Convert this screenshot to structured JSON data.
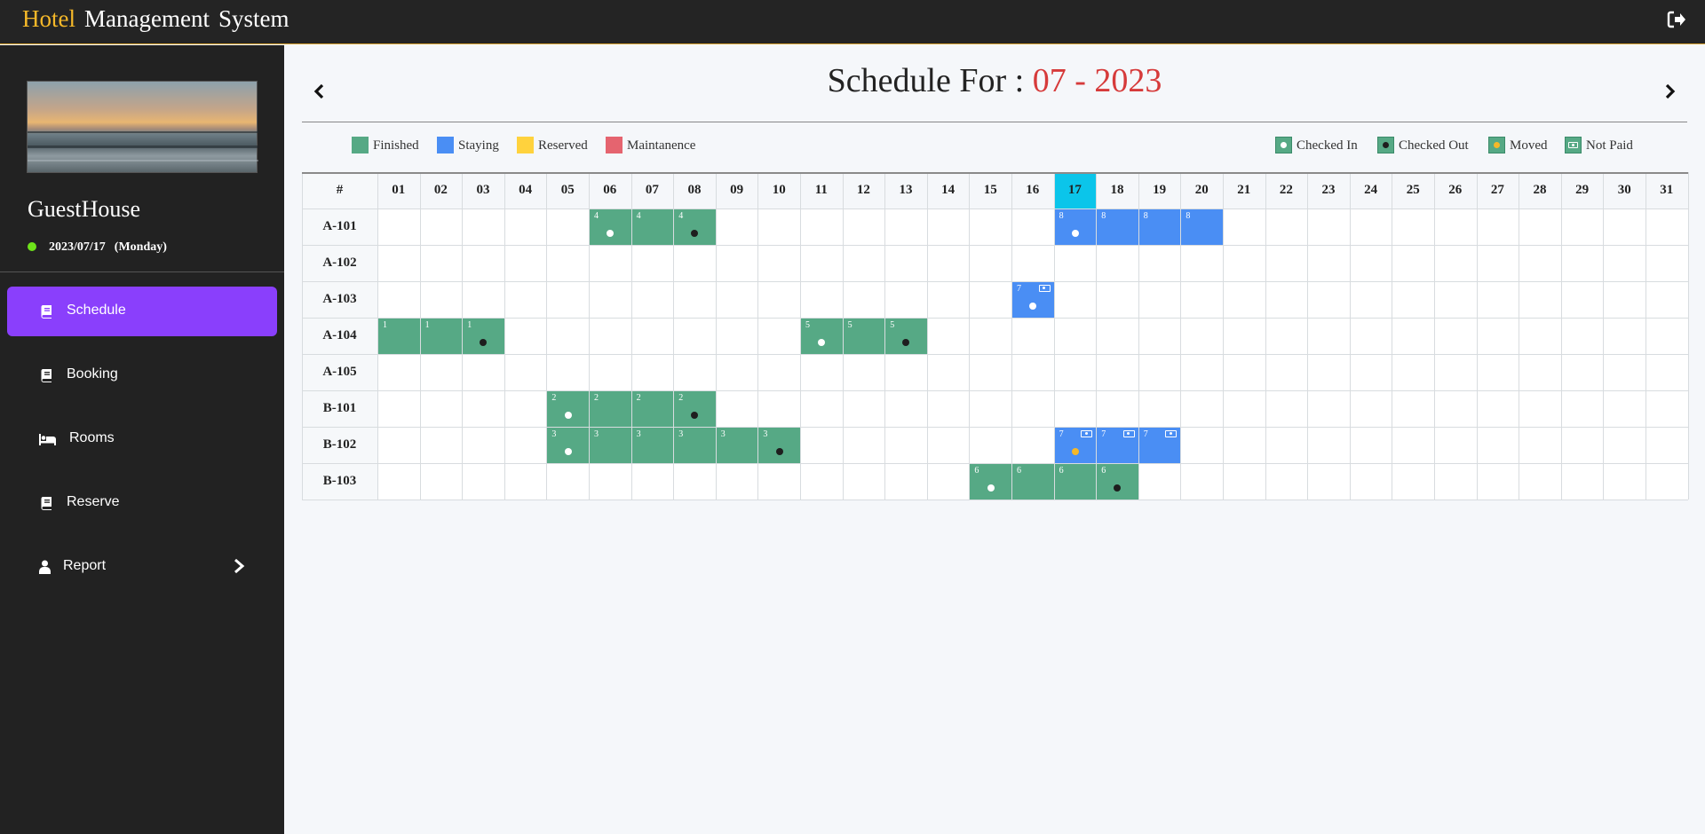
{
  "app": {
    "title_part1": "Hotel",
    "title_part2": "Management",
    "title_part3": "System"
  },
  "topbar": {
    "logout_icon": "sign-out-icon"
  },
  "sidebar": {
    "property_name": "GuestHouse",
    "current_date": "2023/07/17",
    "current_day": "(Monday)",
    "status_color": "#6ee31a",
    "items": [
      {
        "label": "Schedule",
        "icon": "book-icon",
        "active": true
      },
      {
        "label": "Booking",
        "icon": "book-icon",
        "active": false
      },
      {
        "label": "Rooms",
        "icon": "bed-icon",
        "active": false
      },
      {
        "label": "Reserve",
        "icon": "book-icon",
        "active": false
      },
      {
        "label": "Report",
        "icon": "user-icon",
        "active": false,
        "has_submenu": true
      }
    ]
  },
  "schedule": {
    "title_prefix": "Schedule For : ",
    "period": "07 - 2023",
    "prev_icon": "chevron-left-icon",
    "next_icon": "chevron-right-icon",
    "legend_status": [
      {
        "label": "Finished",
        "color": "#56a985"
      },
      {
        "label": "Staying",
        "color": "#4a8ef4"
      },
      {
        "label": "Reserved",
        "color": "#ffd23d"
      },
      {
        "label": "Maintanence",
        "color": "#e5646f"
      }
    ],
    "legend_markers": [
      {
        "label": "Checked In",
        "marker": "white-dot"
      },
      {
        "label": "Checked Out",
        "marker": "black-dot"
      },
      {
        "label": "Moved",
        "marker": "yellow-dot"
      },
      {
        "label": "Not Paid",
        "marker": "cash-icon"
      }
    ],
    "header_hash": "#",
    "days": [
      "01",
      "02",
      "03",
      "04",
      "05",
      "06",
      "07",
      "08",
      "09",
      "10",
      "11",
      "12",
      "13",
      "14",
      "15",
      "16",
      "17",
      "18",
      "19",
      "20",
      "21",
      "22",
      "23",
      "24",
      "25",
      "26",
      "27",
      "28",
      "29",
      "30",
      "31"
    ],
    "today": "17",
    "rooms": [
      "A-101",
      "A-102",
      "A-103",
      "A-104",
      "A-105",
      "B-101",
      "B-102",
      "B-103"
    ],
    "bookings": [
      {
        "room": "A-101",
        "id": "4",
        "status": "finished",
        "start": 6,
        "end": 8,
        "checkin_day": 6,
        "checkout_day": 8,
        "unpaid_days": []
      },
      {
        "room": "A-101",
        "id": "8",
        "status": "staying",
        "start": 17,
        "end": 20,
        "checkin_day": 17,
        "checkout_day": null,
        "unpaid_days": []
      },
      {
        "room": "A-103",
        "id": "7",
        "status": "staying",
        "start": 16,
        "end": 16,
        "checkin_day": 16,
        "checkout_day": null,
        "unpaid_days": [
          16
        ]
      },
      {
        "room": "A-104",
        "id": "1",
        "status": "finished",
        "start": 1,
        "end": 3,
        "checkin_day": null,
        "checkout_day": 3,
        "unpaid_days": []
      },
      {
        "room": "A-104",
        "id": "5",
        "status": "finished",
        "start": 11,
        "end": 13,
        "checkin_day": 11,
        "checkout_day": 13,
        "unpaid_days": []
      },
      {
        "room": "B-101",
        "id": "2",
        "status": "finished",
        "start": 5,
        "end": 8,
        "checkin_day": 5,
        "checkout_day": 8,
        "unpaid_days": []
      },
      {
        "room": "B-102",
        "id": "3",
        "status": "finished",
        "start": 5,
        "end": 10,
        "checkin_day": 5,
        "checkout_day": 10,
        "unpaid_days": []
      },
      {
        "room": "B-102",
        "id": "7",
        "status": "staying",
        "start": 17,
        "end": 19,
        "checkin_day": null,
        "moved_day": 17,
        "checkout_day": null,
        "unpaid_days": [
          17,
          18,
          19
        ]
      },
      {
        "room": "B-103",
        "id": "6",
        "status": "finished",
        "start": 15,
        "end": 18,
        "checkin_day": 15,
        "checkout_day": 18,
        "unpaid_days": []
      }
    ],
    "colors": {
      "finished": "#56a985",
      "staying": "#4a8ef4",
      "reserved": "#ffd23d",
      "maintenance": "#e5646f",
      "today_header": "#0bc5ea",
      "checked_in_dot": "#ffffff",
      "checked_out_dot": "#1e1e1e",
      "moved_dot": "#f5b829"
    }
  }
}
